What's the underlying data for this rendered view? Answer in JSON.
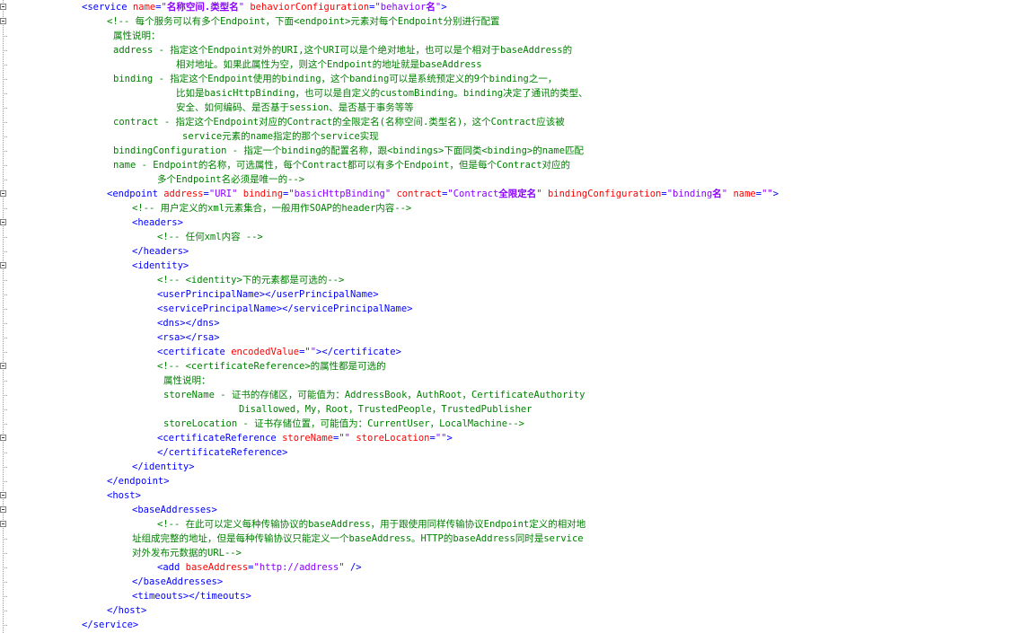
{
  "editor": {
    "lines": [
      {
        "indent": 91,
        "segs": [
          [
            "p",
            "<"
          ],
          [
            "t",
            "service"
          ],
          [
            "x",
            " "
          ],
          [
            "a",
            "name"
          ],
          [
            "p",
            "="
          ],
          [
            "v",
            "\""
          ],
          [
            "vb",
            "名称空间.类型名"
          ],
          [
            "v",
            "\""
          ],
          [
            "x",
            " "
          ],
          [
            "a",
            "behaviorConfiguration"
          ],
          [
            "p",
            "="
          ],
          [
            "v",
            "\"behavior"
          ],
          [
            "vb",
            "名"
          ],
          [
            "v",
            "\""
          ],
          [
            "p",
            ">"
          ]
        ]
      },
      {
        "indent": 119,
        "segs": [
          [
            "c",
            "<!-- 每个服务可以有多个Endpoint，下面<endpoint>元素对每个Endpoint分别进行配置"
          ]
        ]
      },
      {
        "indent": 126,
        "segs": [
          [
            "c",
            "属性说明："
          ]
        ]
      },
      {
        "indent": 126,
        "segs": [
          [
            "c",
            "address - 指定这个Endpoint对外的URI,这个URI可以是个绝对地址，也可以是个相对于baseAddress的"
          ]
        ]
      },
      {
        "indent": 196,
        "segs": [
          [
            "c",
            "相对地址。如果此属性为空，则这个Endpoint的地址就是baseAddress"
          ]
        ]
      },
      {
        "indent": 126,
        "segs": [
          [
            "c",
            "binding - 指定这个Endpoint使用的binding，这个banding可以是系统预定义的9个binding之一，"
          ]
        ]
      },
      {
        "indent": 196,
        "segs": [
          [
            "c",
            "比如是basicHttpBinding，也可以是自定义的customBinding。binding决定了通讯的类型、"
          ]
        ]
      },
      {
        "indent": 196,
        "segs": [
          [
            "c",
            "安全、如何编码、是否基于session、是否基于事务等等"
          ]
        ]
      },
      {
        "indent": 126,
        "segs": [
          [
            "c",
            "contract - 指定这个Endpoint对应的Contract的全限定名(名称空间.类型名)，这个Contract应该被"
          ]
        ]
      },
      {
        "indent": 203,
        "segs": [
          [
            "c",
            "service元素的name指定的那个service实现"
          ]
        ]
      },
      {
        "indent": 126,
        "segs": [
          [
            "c",
            "bindingConfiguration - 指定一个binding的配置名称，跟<bindings>下面同类<binding>的name匹配"
          ]
        ]
      },
      {
        "indent": 126,
        "segs": [
          [
            "c",
            "name - Endpoint的名称，可选属性，每个Contract都可以有多个Endpoint，但是每个Contract对应的"
          ]
        ]
      },
      {
        "indent": 175,
        "segs": [
          [
            "c",
            "多个Endpoint名必须是唯一的-->"
          ]
        ]
      },
      {
        "indent": 119,
        "segs": [
          [
            "p",
            "<"
          ],
          [
            "t",
            "endpoint"
          ],
          [
            "x",
            " "
          ],
          [
            "a",
            "address"
          ],
          [
            "p",
            "="
          ],
          [
            "v",
            "\"URI\""
          ],
          [
            "x",
            " "
          ],
          [
            "a",
            "binding"
          ],
          [
            "p",
            "="
          ],
          [
            "v",
            "\"basicHttpBinding\""
          ],
          [
            "x",
            " "
          ],
          [
            "a",
            "contract"
          ],
          [
            "p",
            "="
          ],
          [
            "v",
            "\"Contract"
          ],
          [
            "vb",
            "全限定名"
          ],
          [
            "v",
            "\""
          ],
          [
            "x",
            " "
          ],
          [
            "a",
            "bindingConfiguration"
          ],
          [
            "p",
            "="
          ],
          [
            "v",
            "\"binding"
          ],
          [
            "vb",
            "名"
          ],
          [
            "v",
            "\""
          ],
          [
            "x",
            " "
          ],
          [
            "a",
            "name"
          ],
          [
            "p",
            "="
          ],
          [
            "v",
            "\"\""
          ],
          [
            "p",
            ">"
          ]
        ]
      },
      {
        "indent": 147,
        "segs": [
          [
            "c",
            "<!-- 用户定义的xml元素集合，一般用作SOAP的header内容-->"
          ]
        ]
      },
      {
        "indent": 147,
        "segs": [
          [
            "p",
            "<"
          ],
          [
            "t",
            "headers"
          ],
          [
            "p",
            ">"
          ]
        ]
      },
      {
        "indent": 175,
        "segs": [
          [
            "c",
            "<!-- 任何xml内容 -->"
          ]
        ]
      },
      {
        "indent": 147,
        "segs": [
          [
            "p",
            "</"
          ],
          [
            "t",
            "headers"
          ],
          [
            "p",
            ">"
          ]
        ]
      },
      {
        "indent": 147,
        "segs": [
          [
            "p",
            "<"
          ],
          [
            "t",
            "identity"
          ],
          [
            "p",
            ">"
          ]
        ]
      },
      {
        "indent": 175,
        "segs": [
          [
            "c",
            "<!-- <identity>下的元素都是可选的-->"
          ]
        ]
      },
      {
        "indent": 175,
        "segs": [
          [
            "p",
            "<"
          ],
          [
            "t",
            "userPrincipalName"
          ],
          [
            "p",
            "></"
          ],
          [
            "t",
            "userPrincipalName"
          ],
          [
            "p",
            ">"
          ]
        ]
      },
      {
        "indent": 175,
        "segs": [
          [
            "p",
            "<"
          ],
          [
            "t",
            "servicePrincipalName"
          ],
          [
            "p",
            "></"
          ],
          [
            "t",
            "servicePrincipalName"
          ],
          [
            "p",
            ">"
          ]
        ]
      },
      {
        "indent": 175,
        "segs": [
          [
            "p",
            "<"
          ],
          [
            "t",
            "dns"
          ],
          [
            "p",
            "></"
          ],
          [
            "t",
            "dns"
          ],
          [
            "p",
            ">"
          ]
        ]
      },
      {
        "indent": 175,
        "segs": [
          [
            "p",
            "<"
          ],
          [
            "t",
            "rsa"
          ],
          [
            "p",
            "></"
          ],
          [
            "t",
            "rsa"
          ],
          [
            "p",
            ">"
          ]
        ]
      },
      {
        "indent": 175,
        "segs": [
          [
            "p",
            "<"
          ],
          [
            "t",
            "certificate"
          ],
          [
            "x",
            " "
          ],
          [
            "a",
            "encodedValue"
          ],
          [
            "p",
            "="
          ],
          [
            "v",
            "\"\""
          ],
          [
            "p",
            "></"
          ],
          [
            "t",
            "certificate"
          ],
          [
            "p",
            ">"
          ]
        ]
      },
      {
        "indent": 175,
        "segs": [
          [
            "c",
            "<!-- <certificateReference>的属性都是可选的"
          ]
        ]
      },
      {
        "indent": 182,
        "segs": [
          [
            "c",
            "属性说明："
          ]
        ]
      },
      {
        "indent": 182,
        "segs": [
          [
            "c",
            "storeName - 证书的存储区，可能值为：AddressBook，AuthRoot，CertificateAuthority"
          ]
        ]
      },
      {
        "indent": 266,
        "segs": [
          [
            "c",
            "Disallowed，My，Root，TrustedPeople，TrustedPublisher"
          ]
        ]
      },
      {
        "indent": 182,
        "segs": [
          [
            "c",
            "storeLocation - 证书存储位置，可能值为：CurrentUser，LocalMachine-->"
          ]
        ]
      },
      {
        "indent": 175,
        "segs": [
          [
            "p",
            "<"
          ],
          [
            "t",
            "certificateReference"
          ],
          [
            "x",
            " "
          ],
          [
            "a",
            "storeName"
          ],
          [
            "p",
            "="
          ],
          [
            "v",
            "\"\""
          ],
          [
            "x",
            " "
          ],
          [
            "a",
            "storeLocation"
          ],
          [
            "p",
            "="
          ],
          [
            "v",
            "\"\""
          ],
          [
            "p",
            ">"
          ]
        ]
      },
      {
        "indent": 175,
        "segs": [
          [
            "p",
            "</"
          ],
          [
            "t",
            "certificateReference"
          ],
          [
            "p",
            ">"
          ]
        ]
      },
      {
        "indent": 147,
        "segs": [
          [
            "p",
            "</"
          ],
          [
            "t",
            "identity"
          ],
          [
            "p",
            ">"
          ]
        ]
      },
      {
        "indent": 119,
        "segs": [
          [
            "p",
            "</"
          ],
          [
            "t",
            "endpoint"
          ],
          [
            "p",
            ">"
          ]
        ]
      },
      {
        "indent": 119,
        "segs": [
          [
            "p",
            "<"
          ],
          [
            "t",
            "host"
          ],
          [
            "p",
            ">"
          ]
        ]
      },
      {
        "indent": 147,
        "segs": [
          [
            "p",
            "<"
          ],
          [
            "t",
            "baseAddresses"
          ],
          [
            "p",
            ">"
          ]
        ]
      },
      {
        "indent": 175,
        "segs": [
          [
            "c",
            "<!-- 在此可以定义每种传输协议的baseAddress，用于跟使用同样传输协议Endpoint定义的相对地"
          ]
        ]
      },
      {
        "indent": 147,
        "segs": [
          [
            "c",
            "址组成完整的地址，但是每种传输协议只能定义一个baseAddress。HTTP的baseAddress同时是service"
          ]
        ]
      },
      {
        "indent": 147,
        "segs": [
          [
            "c",
            "对外发布元数据的URL-->"
          ]
        ]
      },
      {
        "indent": 175,
        "segs": [
          [
            "p",
            "<"
          ],
          [
            "t",
            "add"
          ],
          [
            "x",
            " "
          ],
          [
            "a",
            "baseAddress"
          ],
          [
            "p",
            "="
          ],
          [
            "v",
            "\"http://address\""
          ],
          [
            "x",
            " "
          ],
          [
            "p",
            "/>"
          ]
        ]
      },
      {
        "indent": 147,
        "segs": [
          [
            "p",
            "</"
          ],
          [
            "t",
            "baseAddresses"
          ],
          [
            "p",
            ">"
          ]
        ]
      },
      {
        "indent": 147,
        "segs": [
          [
            "p",
            "<"
          ],
          [
            "t",
            "timeouts"
          ],
          [
            "p",
            "></"
          ],
          [
            "t",
            "timeouts"
          ],
          [
            "p",
            ">"
          ]
        ]
      },
      {
        "indent": 119,
        "segs": [
          [
            "p",
            "</"
          ],
          [
            "t",
            "host"
          ],
          [
            "p",
            ">"
          ]
        ]
      },
      {
        "indent": 91,
        "segs": [
          [
            "p",
            "</"
          ],
          [
            "t",
            "service"
          ],
          [
            "p",
            ">"
          ]
        ]
      }
    ],
    "fold_markers_at_lines": [
      0,
      1,
      13,
      15,
      18,
      25,
      30,
      34,
      35,
      36
    ]
  }
}
